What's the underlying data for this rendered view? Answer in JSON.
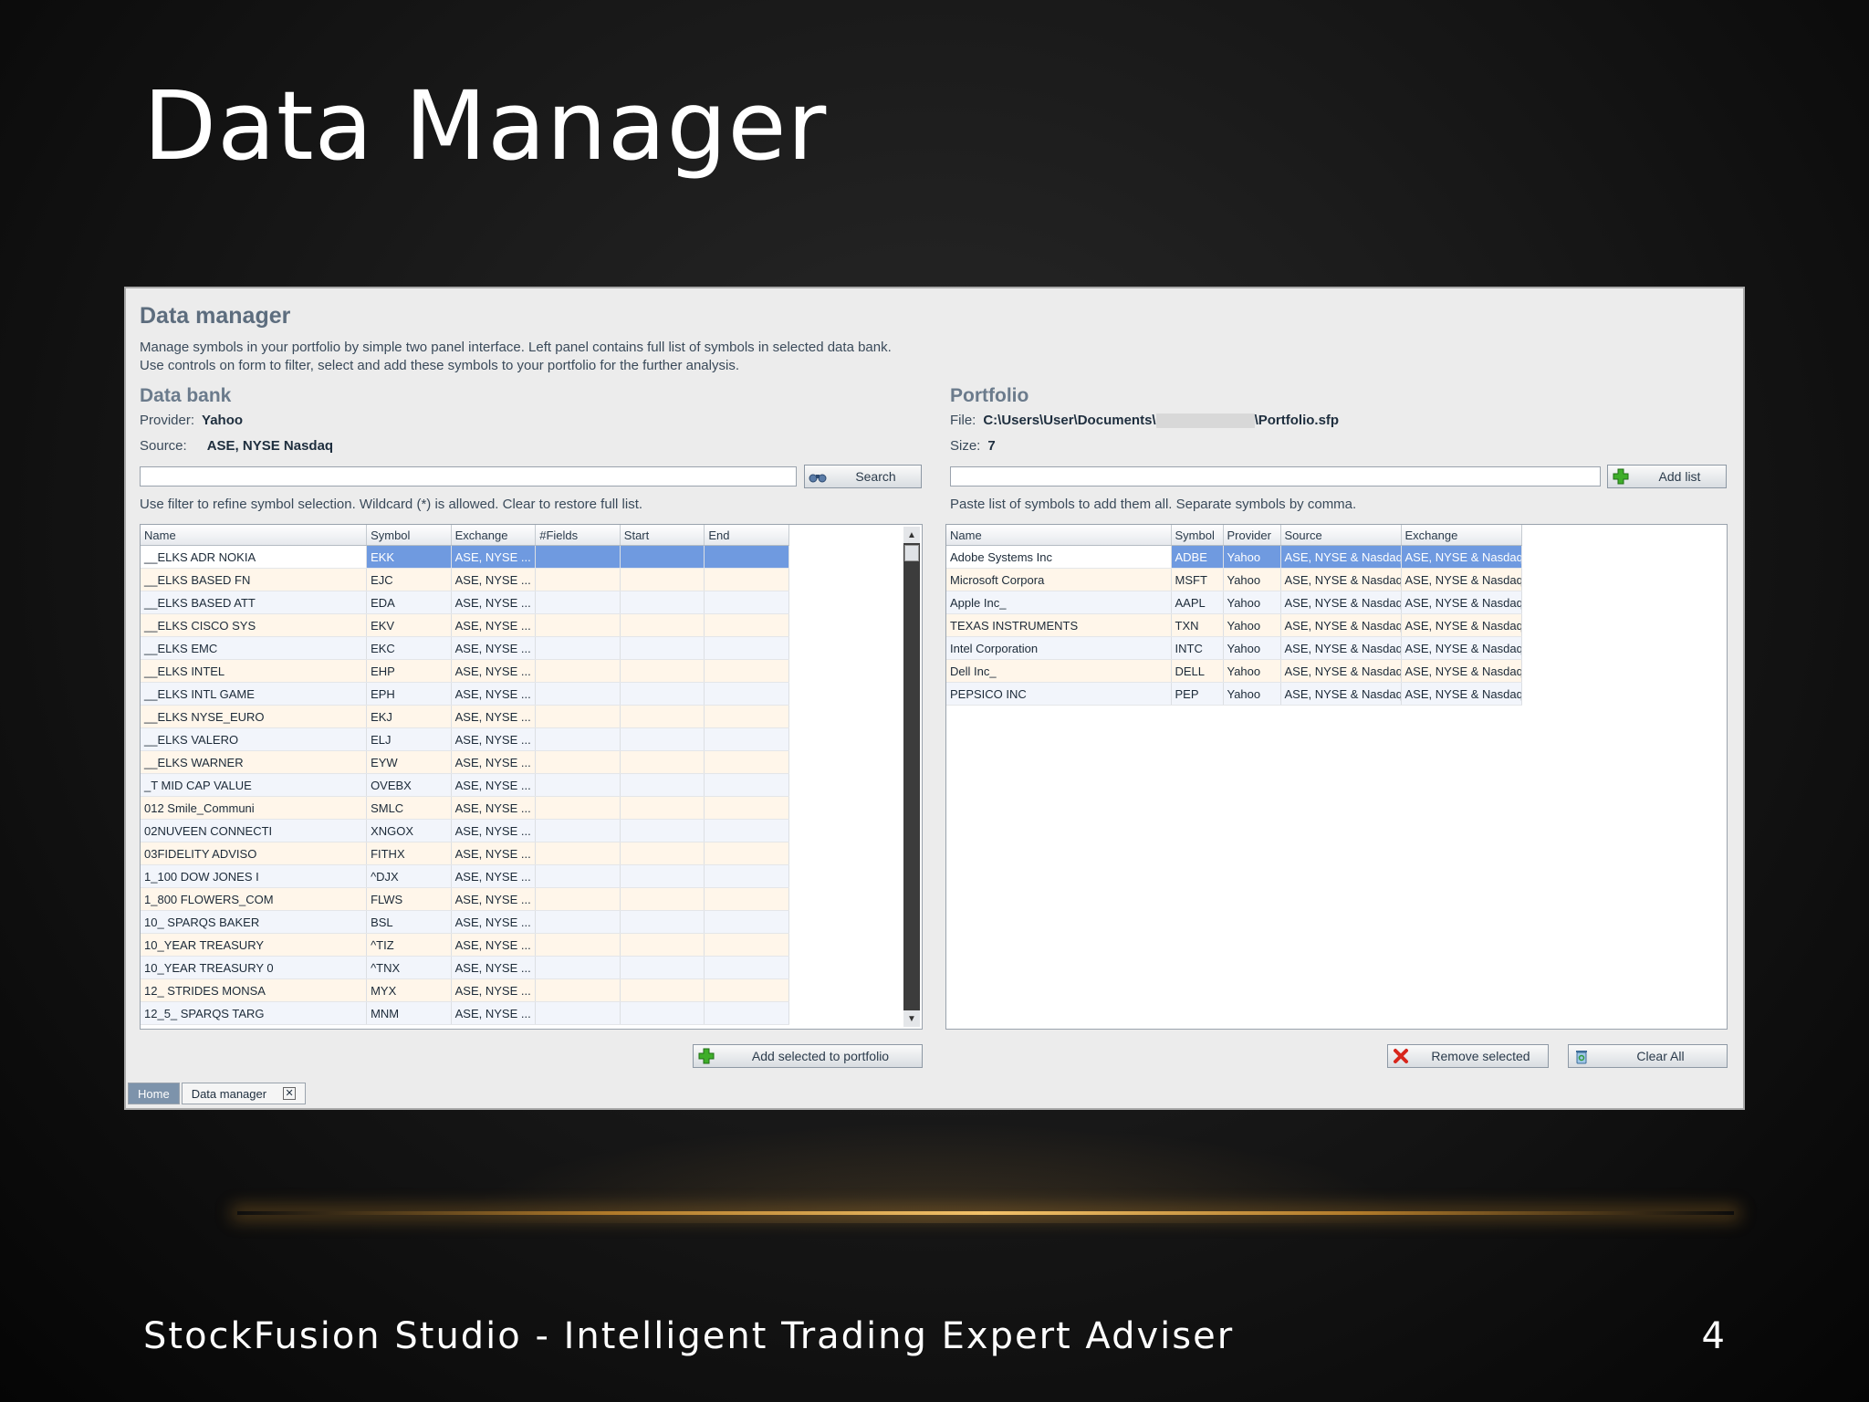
{
  "slide": {
    "title": "Data Manager",
    "footer": "StockFusion Studio - Intelligent Trading Expert Adviser",
    "page_number": "4"
  },
  "app": {
    "header": "Data manager",
    "desc_line1": "Manage symbols in your portfolio by simple two panel interface. Left panel contains full list of symbols in selected data bank.",
    "desc_line2": "Use controls on form to filter, select and add these symbols to your portfolio for the further analysis.",
    "databank": {
      "title": "Data bank",
      "provider_label": "Provider:",
      "provider_value": "Yahoo",
      "source_label": "Source:",
      "source_value": "ASE, NYSE  Nasdaq",
      "search_button": "Search",
      "hint": "Use filter to refine symbol selection. Wildcard (*) is allowed. Clear to restore full list.",
      "columns": [
        "Name",
        "Symbol",
        "Exchange",
        "#Fields",
        "Start",
        "End"
      ],
      "rows": [
        [
          "__ELKS ADR NOKIA",
          "EKK",
          "ASE, NYSE ..."
        ],
        [
          "__ELKS BASED  FN",
          "EJC",
          "ASE, NYSE ..."
        ],
        [
          "__ELKS BASED ATT",
          "EDA",
          "ASE, NYSE ..."
        ],
        [
          "__ELKS CISCO SYS",
          "EKV",
          "ASE, NYSE ..."
        ],
        [
          "__ELKS EMC",
          "EKC",
          "ASE, NYSE ..."
        ],
        [
          "__ELKS INTEL",
          "EHP",
          "ASE, NYSE ..."
        ],
        [
          "__ELKS INTL GAME",
          "EPH",
          "ASE, NYSE ..."
        ],
        [
          "__ELKS NYSE_EURO",
          "EKJ",
          "ASE, NYSE ..."
        ],
        [
          "__ELKS VALERO",
          "ELJ",
          "ASE, NYSE ..."
        ],
        [
          "__ELKS WARNER",
          "EYW",
          "ASE, NYSE ..."
        ],
        [
          "_T MID CAP VALUE",
          "OVEBX",
          "ASE, NYSE ..."
        ],
        [
          "012 Smile_Communi",
          "SMLC",
          "ASE, NYSE ..."
        ],
        [
          "02NUVEEN CONNECTI",
          "XNGOX",
          "ASE, NYSE ..."
        ],
        [
          "03FIDELITY ADVISO",
          "FITHX",
          "ASE, NYSE ..."
        ],
        [
          "1_100 DOW JONES I",
          "^DJX",
          "ASE, NYSE ..."
        ],
        [
          "1_800 FLOWERS_COM",
          "FLWS",
          "ASE, NYSE ..."
        ],
        [
          "10_ SPARQS BAKER",
          "BSL",
          "ASE, NYSE ..."
        ],
        [
          "10_YEAR TREASURY",
          "^TIZ",
          "ASE, NYSE ..."
        ],
        [
          "10_YEAR TREASURY 0",
          "^TNX",
          "ASE, NYSE ..."
        ],
        [
          "12_ STRIDES MONSA",
          "MYX",
          "ASE, NYSE ..."
        ],
        [
          "12_5_ SPARQS TARG",
          "MNM",
          "ASE, NYSE ..."
        ]
      ],
      "add_button": "Add selected to portfolio"
    },
    "portfolio": {
      "title": "Portfolio",
      "file_label": "File:",
      "file_prefix": "C:\\Users\\User\\Documents\\",
      "file_suffix": "\\Portfolio.sfp",
      "size_label": "Size:",
      "size_value": "7",
      "add_list_button": "Add list",
      "hint": "Paste list of symbols to add them all. Separate symbols by comma.",
      "columns": [
        "Name",
        "Symbol",
        "Provider",
        "Source",
        "Exchange"
      ],
      "rows": [
        [
          "Adobe Systems Inc",
          "ADBE",
          "Yahoo",
          "ASE, NYSE & Nasdaq",
          "ASE, NYSE & Nasdaq"
        ],
        [
          "Microsoft Corpora",
          "MSFT",
          "Yahoo",
          "ASE, NYSE & Nasdaq",
          "ASE, NYSE & Nasdaq"
        ],
        [
          "Apple Inc_",
          "AAPL",
          "Yahoo",
          "ASE, NYSE & Nasdaq",
          "ASE, NYSE & Nasdaq"
        ],
        [
          "TEXAS INSTRUMENTS",
          "TXN",
          "Yahoo",
          "ASE, NYSE & Nasdaq",
          "ASE, NYSE & Nasdaq"
        ],
        [
          "Intel Corporation",
          "INTC",
          "Yahoo",
          "ASE, NYSE & Nasdaq",
          "ASE, NYSE & Nasdaq"
        ],
        [
          "Dell Inc_",
          "DELL",
          "Yahoo",
          "ASE, NYSE & Nasdaq",
          "ASE, NYSE & Nasdaq"
        ],
        [
          "PEPSICO INC",
          "PEP",
          "Yahoo",
          "ASE, NYSE & Nasdaq",
          "ASE, NYSE & Nasdaq"
        ]
      ],
      "remove_button": "Remove selected",
      "clear_button": "Clear All"
    },
    "tabs": {
      "home": "Home",
      "active": "Data manager",
      "close": "✕"
    }
  }
}
